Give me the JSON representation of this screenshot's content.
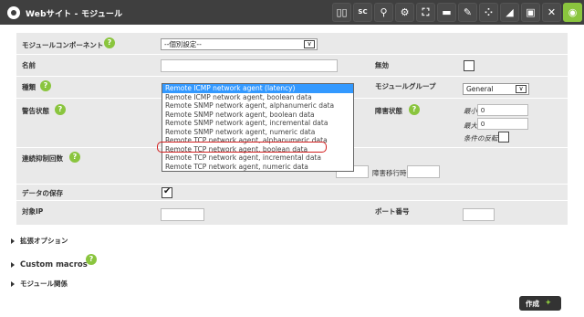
{
  "header": {
    "title": "Webサイト - モジュール",
    "active_tab": "module"
  },
  "toolbar": [
    "library",
    "sc",
    "wrench",
    "plugins",
    "network",
    "folder",
    "edit",
    "map",
    "alerts",
    "graph",
    "tools",
    "eye"
  ],
  "fields": {
    "module_component": {
      "label": "モジュールコンポーネント",
      "value": "--個別設定--"
    },
    "name": {
      "label": "名前",
      "value": ""
    },
    "disabled": {
      "label": "無効"
    },
    "type": {
      "label": "種類"
    },
    "module_group": {
      "label": "モジュールグループ",
      "value": "General"
    },
    "warning_status": {
      "label": "警告状態"
    },
    "critical_status": {
      "label": "障害状態",
      "min_label": "最小",
      "min_value": "0",
      "max_label": "最大",
      "max_value": "0",
      "inverse_label": "条件の反転"
    },
    "ff_threshold": {
      "label": "連続抑制回数",
      "recovery_label": "障害移行時"
    },
    "historical_data": {
      "label": "データの保存"
    },
    "target_ip": {
      "label": "対象IP",
      "value": ""
    },
    "port": {
      "label": "ポート番号",
      "value": ""
    }
  },
  "dropdown": {
    "items": [
      "Remote ICMP network agent (latency)",
      "Remote ICMP network agent, boolean data",
      "Remote SNMP network agent, alphanumeric data",
      "Remote SNMP network agent, boolean data",
      "Remote SNMP network agent, incremental data",
      "Remote SNMP network agent, numeric data",
      "Remote TCP network agent, alphanumeric data",
      "Remote TCP network agent, boolean data",
      "Remote TCP network agent, incremental data",
      "Remote TCP network agent, numeric data"
    ],
    "selected_index": 0,
    "highlighted_index": 7
  },
  "sections": {
    "advanced": "拡張オプション",
    "macros": "Custom macros",
    "relations": "モジュール関係"
  },
  "create_button": "作成",
  "colors": {
    "header": "#3f3f3f",
    "accent": "#8ac53e",
    "highlight": "#d31d1d",
    "selected": "#3399ff"
  }
}
